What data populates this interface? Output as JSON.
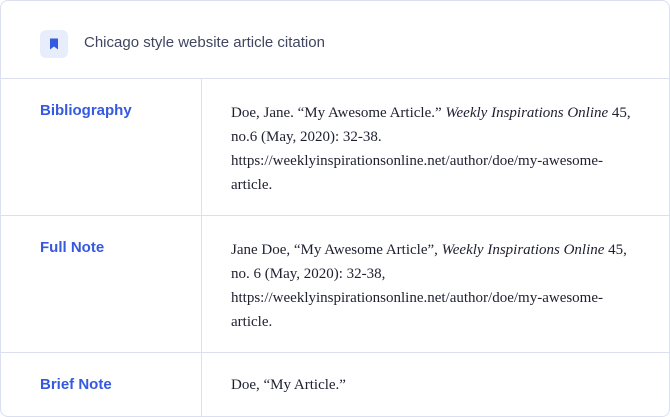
{
  "header": {
    "icon": "bookmark-icon",
    "title": "Chicago style website article citation"
  },
  "accent_color": "#3559e0",
  "rows": [
    {
      "label": "Bibliography",
      "citation": {
        "before": "Doe, Jane. “My Awesome Article.” ",
        "italic": "Weekly Inspirations Online",
        "after": " 45, no.6 (May, 2020): 32-38. https://weeklyinspirationsonline.net/author/doe/my-awesome-article."
      }
    },
    {
      "label": "Full Note",
      "citation": {
        "before": "Jane Doe, “My Awesome Article”, ",
        "italic": "Weekly Inspirations Online",
        "after": " 45, no. 6 (May, 2020): 32-38, https://weeklyinspirationsonline.net/author/doe/my-awesome-article."
      }
    },
    {
      "label": "Brief Note",
      "citation": {
        "before": "Doe, “My Article.”",
        "italic": "",
        "after": ""
      }
    }
  ]
}
